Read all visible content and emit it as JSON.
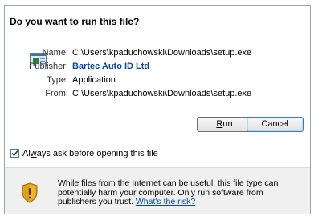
{
  "dialog": {
    "title": "Do you want to run this file?"
  },
  "file_info": {
    "name_label": "Name:",
    "name_value": "C:\\Users\\kpaduchowski\\Downloads\\setup.exe",
    "publisher_label": "Publisher:",
    "publisher_value": "Bartec Auto ID Ltd",
    "type_label": "Type:",
    "type_value": "Application",
    "from_label": "From:",
    "from_value": "C:\\Users\\kpaduchowski\\Downloads\\setup.exe",
    "icon": "application-file-icon"
  },
  "buttons": {
    "run_label": "Run",
    "run_accelerator": "R",
    "cancel_label": "Cancel"
  },
  "checkbox": {
    "label": "Always ask before opening this file",
    "checked": true
  },
  "warning": {
    "icon": "shield-warning-icon",
    "text": "While files from the Internet can be useful, this file type can potentially harm your computer. Only run software from publishers you trust.",
    "link_label": "What's the risk?"
  },
  "colors": {
    "link": "#0645ad",
    "bottom_panel": "#f0f0f0",
    "shield_gold": "#e3a319"
  }
}
